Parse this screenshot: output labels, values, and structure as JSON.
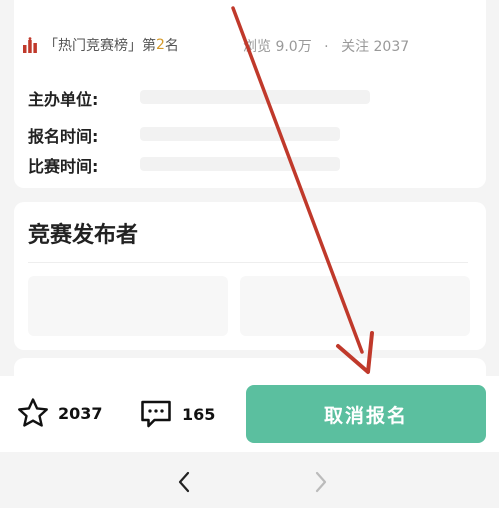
{
  "info_card": {
    "rank_label": "「热门竞赛榜」第",
    "rank_number": "2",
    "rank_suffix": "名",
    "views": "浏览 9.0万",
    "separator": "·",
    "follows": "关注 2037",
    "fields": [
      {
        "label": "主办单位:"
      },
      {
        "label": "报名时间:"
      },
      {
        "label": "比赛时间:"
      }
    ]
  },
  "publisher_card": {
    "title": "竞赛发布者"
  },
  "bottom_bar": {
    "favorite_count": "2037",
    "comment_count": "165",
    "cancel_label": "取消报名",
    "accent_color": "#5bbf9f"
  },
  "nav": {
    "back_icon": "chevron-left-icon",
    "forward_icon": "chevron-right-icon"
  },
  "annotation": {
    "arrow_color": "#c0392b"
  }
}
